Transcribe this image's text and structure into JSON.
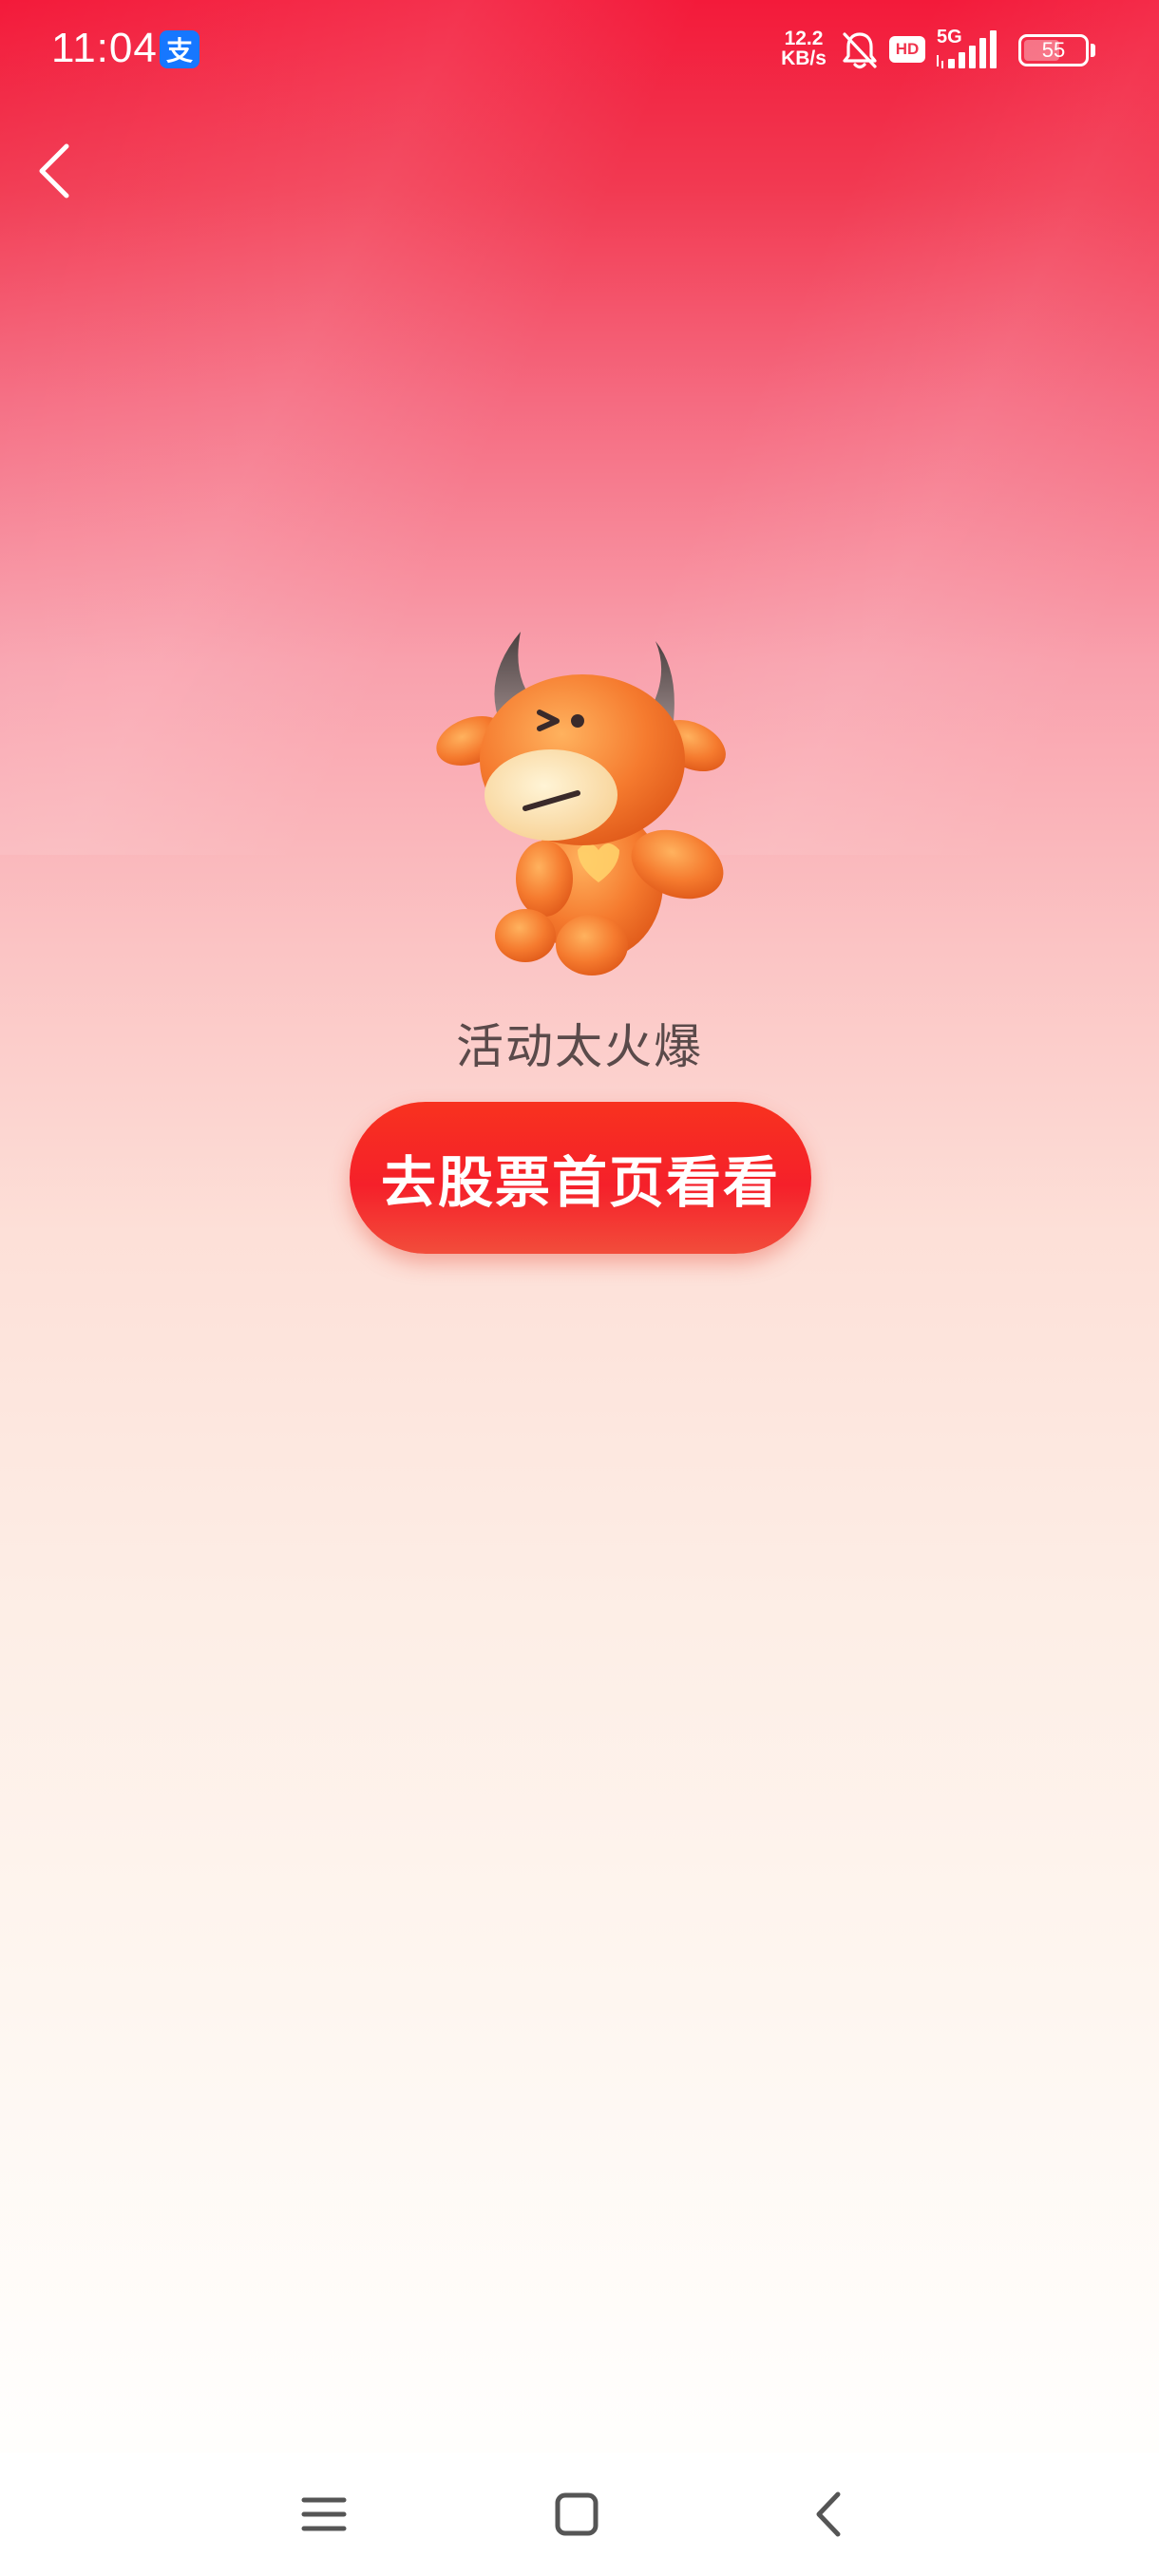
{
  "status_bar": {
    "time": "11:04",
    "app_badge": "支",
    "net_speed_value": "12.2",
    "net_speed_unit": "KB/s",
    "hd_label": "HD",
    "network_label": "5G",
    "battery_level": "55",
    "icons": [
      "alipay-icon",
      "bell-muted-icon",
      "hd-icon",
      "signal-icon",
      "battery-icon"
    ]
  },
  "header": {
    "back_icon": "chevron-left-icon"
  },
  "main": {
    "mascot_icon": "bull-mascot-icon",
    "message": "活动太火爆",
    "cta_label": "去股票首页看看"
  },
  "nav": {
    "icons": [
      "menu-icon",
      "home-square-icon",
      "back-chevron-icon"
    ]
  },
  "colors": {
    "top_red": "#f31a3a",
    "button_red": "#f5202a",
    "alipay_blue": "#1677ff",
    "mascot_orange": "#f57a2e"
  }
}
